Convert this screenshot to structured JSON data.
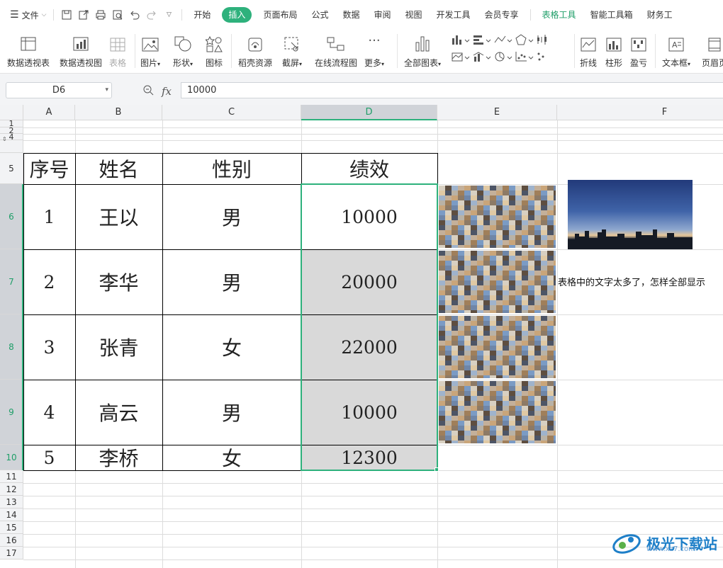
{
  "menubar": {
    "file_label": "文件",
    "tabs": [
      "开始",
      "插入",
      "页面布局",
      "公式",
      "数据",
      "审阅",
      "视图",
      "开发工具",
      "会员专享",
      "表格工具",
      "智能工具箱",
      "财务工"
    ],
    "active_tab": "插入",
    "accent_tab": "表格工具"
  },
  "ribbon": {
    "pivot_table": "数据透视表",
    "pivot_chart": "数据透视图",
    "table": "表格",
    "picture": "图片",
    "shape": "形状",
    "icon": "图标",
    "daoke": "稻壳资源",
    "screenshot": "截屏",
    "flowchart": "在线流程图",
    "more": "更多",
    "all_charts": "全部图表",
    "line": "折线",
    "column": "柱形",
    "winloss": "盈亏",
    "textbox": "文本框",
    "header_footer": "页眉页"
  },
  "formula_bar": {
    "name_box": "D6",
    "fx": "fx",
    "value": "10000"
  },
  "columns": [
    "A",
    "B",
    "C",
    "D",
    "E",
    "F"
  ],
  "rows": [
    "1",
    "2",
    "4",
    "5",
    "6",
    "7",
    "8",
    "9",
    "10",
    "11",
    "12",
    "13",
    "14",
    "15",
    "16",
    "17"
  ],
  "table": {
    "headers": [
      "序号",
      "姓名",
      "性别",
      "绩效"
    ],
    "rows": [
      [
        "1",
        "王以",
        "男",
        "10000"
      ],
      [
        "2",
        "李华",
        "男",
        "20000"
      ],
      [
        "3",
        "张青",
        "女",
        "22000"
      ],
      [
        "4",
        "高云",
        "男",
        "10000"
      ],
      [
        "5",
        "李桥",
        "女",
        "12300"
      ]
    ]
  },
  "f7_text": "表格中的文字太多了，怎样全部显示",
  "watermark": "极光下载站",
  "watermark_url": "www.xz7.com",
  "colors": {
    "accent": "#2eb17c",
    "selected_fill": "#d9d9d9",
    "logo": "#1e7fc8"
  }
}
